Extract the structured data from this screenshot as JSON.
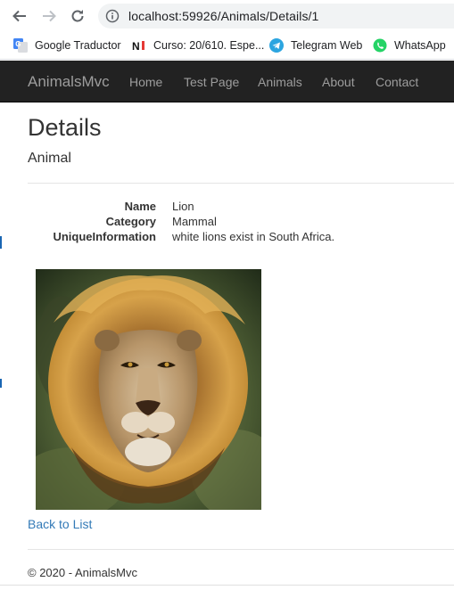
{
  "browser": {
    "url": "localhost:59926/Animals/Details/1",
    "bookmarks": [
      {
        "label": "Google Traductor",
        "icon": "google-translate-icon"
      },
      {
        "label": "Curso: 20/610. Espe...",
        "icon": "ni-logo-icon"
      },
      {
        "label": "Telegram Web",
        "icon": "telegram-icon"
      },
      {
        "label": "WhatsApp",
        "icon": "whatsapp-icon"
      }
    ]
  },
  "navbar": {
    "brand": "AnimalsMvc",
    "links": [
      "Home",
      "Test Page",
      "Animals",
      "About",
      "Contact"
    ]
  },
  "page": {
    "title": "Details",
    "subtitle": "Animal",
    "fields": [
      {
        "label": "Name",
        "value": "Lion"
      },
      {
        "label": "Category",
        "value": "Mammal"
      },
      {
        "label": "UniqueInformation",
        "value": "white lions exist in South Africa."
      }
    ],
    "back_link": "Back to List",
    "footer": "© 2020 - AnimalsMvc"
  },
  "colors": {
    "navbar_bg": "#222222",
    "nav_text": "#9d9d9d",
    "link": "#337ab7"
  }
}
